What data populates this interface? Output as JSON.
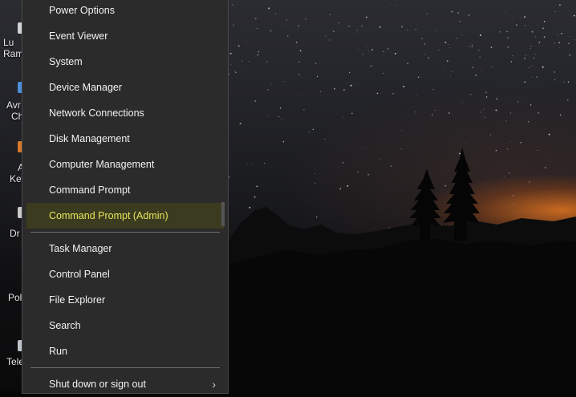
{
  "desktop": {
    "icons": [
      {
        "label_line1": "Lu",
        "label_line2": "Ram"
      },
      {
        "label_line1": "Avr",
        "label_line2": "Ch"
      },
      {
        "label_line1": "A",
        "label_line2": "Key"
      },
      {
        "label_line1": "Dr",
        "label_line2": ""
      },
      {
        "label_line1": "Pol",
        "label_line2": ""
      },
      {
        "label_line1": "Tele",
        "label_line2": ""
      }
    ]
  },
  "menu": {
    "group1": [
      {
        "label": "Power Options"
      },
      {
        "label": "Event Viewer"
      },
      {
        "label": "System"
      },
      {
        "label": "Device Manager"
      },
      {
        "label": "Network Connections"
      },
      {
        "label": "Disk Management"
      },
      {
        "label": "Computer Management"
      },
      {
        "label": "Command Prompt"
      },
      {
        "label": "Command Prompt (Admin)"
      }
    ],
    "group2": [
      {
        "label": "Task Manager"
      },
      {
        "label": "Control Panel"
      },
      {
        "label": "File Explorer"
      },
      {
        "label": "Search"
      },
      {
        "label": "Run"
      }
    ],
    "group3": [
      {
        "label": "Shut down or sign out",
        "submenu_glyph": "›"
      }
    ],
    "highlighted": "Command Prompt (Admin)",
    "colors": {
      "highlight_bg": "#3b3b20",
      "highlight_text": "#e9e65a",
      "menu_bg": "#2b2b2b"
    }
  }
}
